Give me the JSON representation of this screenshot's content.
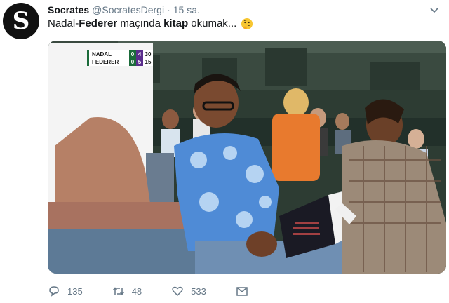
{
  "tweet": {
    "author_name": "Socrates",
    "author_handle": "@SocratesDergi",
    "separator": "·",
    "time": "15 sa.",
    "avatar_letter": "S",
    "text_part1": "Nadal-",
    "text_bold1": "Federer",
    "text_part2": " maçında ",
    "text_bold2": "kitap",
    "text_part3": " okumak...",
    "emoji": "thinking-face"
  },
  "scoreboard": {
    "players": [
      {
        "name": "NADAL",
        "sets": "0",
        "games": "4",
        "points": "30"
      },
      {
        "name": "FEDERER",
        "sets": "0",
        "games": "5",
        "points": "15"
      }
    ]
  },
  "actions": {
    "replies": "135",
    "retweets": "48",
    "likes": "533"
  },
  "colors": {
    "text": "#14171a",
    "secondary": "#657786",
    "score_green": "#1b6b3a",
    "score_purple": "#5a2d8c"
  }
}
